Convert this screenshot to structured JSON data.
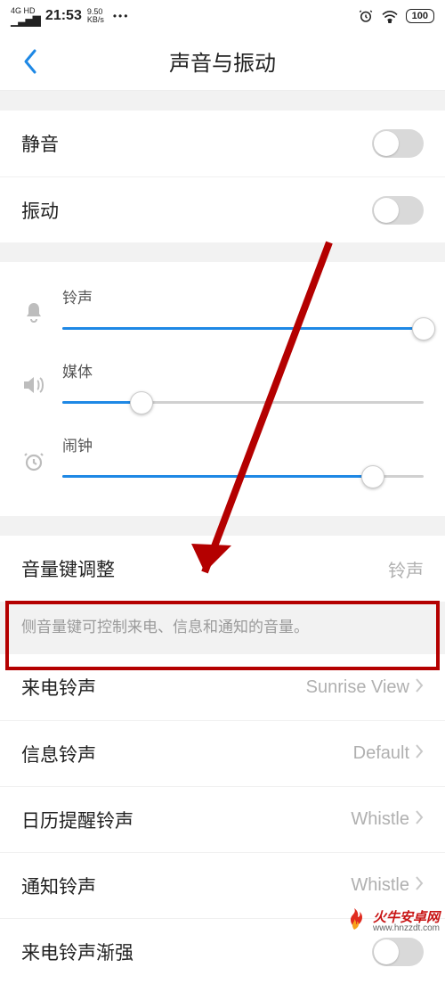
{
  "status": {
    "net": "4G HD",
    "time": "21:53",
    "speed_top": "9.50",
    "speed_bot": "KB/s",
    "dots": "•••",
    "battery": "100"
  },
  "header": {
    "title": "声音与振动"
  },
  "toggles": {
    "mute_label": "静音",
    "vibrate_label": "振动"
  },
  "sliders": {
    "ringtone": {
      "label": "铃声",
      "value": 100
    },
    "media": {
      "label": "媒体",
      "value": 22
    },
    "alarm": {
      "label": "闹钟",
      "value": 86
    }
  },
  "volume_key": {
    "label": "音量键调整",
    "value": "铃声",
    "desc": "侧音量键可控制来电、信息和通知的音量。"
  },
  "rows": {
    "call": {
      "label": "来电铃声",
      "value": "Sunrise View"
    },
    "message": {
      "label": "信息铃声",
      "value": "Default"
    },
    "calendar": {
      "label": "日历提醒铃声",
      "value": "Whistle"
    },
    "notify": {
      "label": "通知铃声",
      "value": "Whistle"
    },
    "fadein": {
      "label": "来电铃声渐强"
    }
  },
  "watermark": {
    "name": "火牛安卓网",
    "url": "www.hnzzdt.com"
  }
}
